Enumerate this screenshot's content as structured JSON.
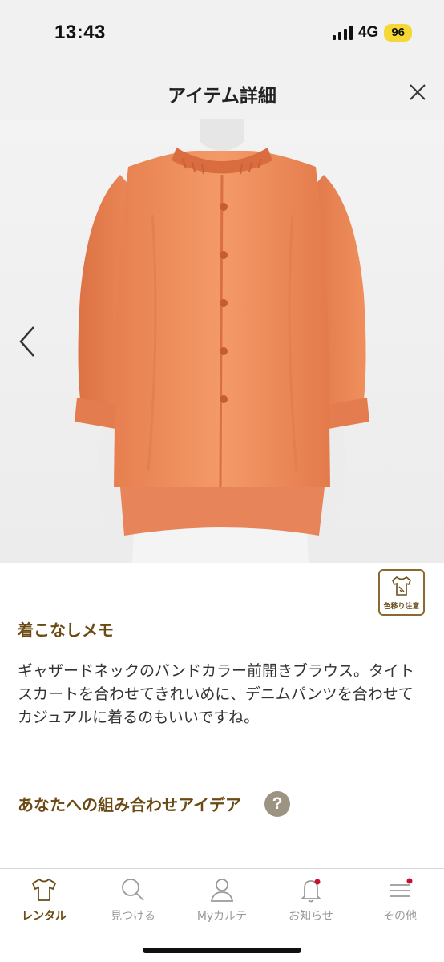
{
  "status_bar": {
    "time": "13:43",
    "network": "4G",
    "battery": "96"
  },
  "header": {
    "title": "アイテム詳細",
    "close_icon": "close-icon"
  },
  "product_image": {
    "garment_color": "#f0915f",
    "prev_icon": "chevron-left-icon"
  },
  "care_badge": {
    "label": "色移り注意",
    "icon": "tshirt-icon"
  },
  "memo": {
    "heading": "着こなしメモ",
    "body": "ギャザードネックのバンドカラー前開きブラウス。タイトスカートを合わせてきれいめに、デニムパンツを合わせてカジュアルに着るのもいいですね。"
  },
  "combination": {
    "heading": "あなたへの組み合わせアイデア",
    "help_icon": "?"
  },
  "tabs": [
    {
      "label": "レンタル",
      "icon": "shirt-icon",
      "active": true
    },
    {
      "label": "見つける",
      "icon": "search-icon",
      "active": false
    },
    {
      "label": "Myカルテ",
      "icon": "person-icon",
      "active": false
    },
    {
      "label": "お知らせ",
      "icon": "bell-icon",
      "active": false,
      "badge": true
    },
    {
      "label": "その他",
      "icon": "menu-icon",
      "active": false,
      "badge": true
    }
  ],
  "colors": {
    "accent_brown": "#6b4a14",
    "notification_dot": "#c8102e",
    "header_bg": "#f2f1f1"
  }
}
